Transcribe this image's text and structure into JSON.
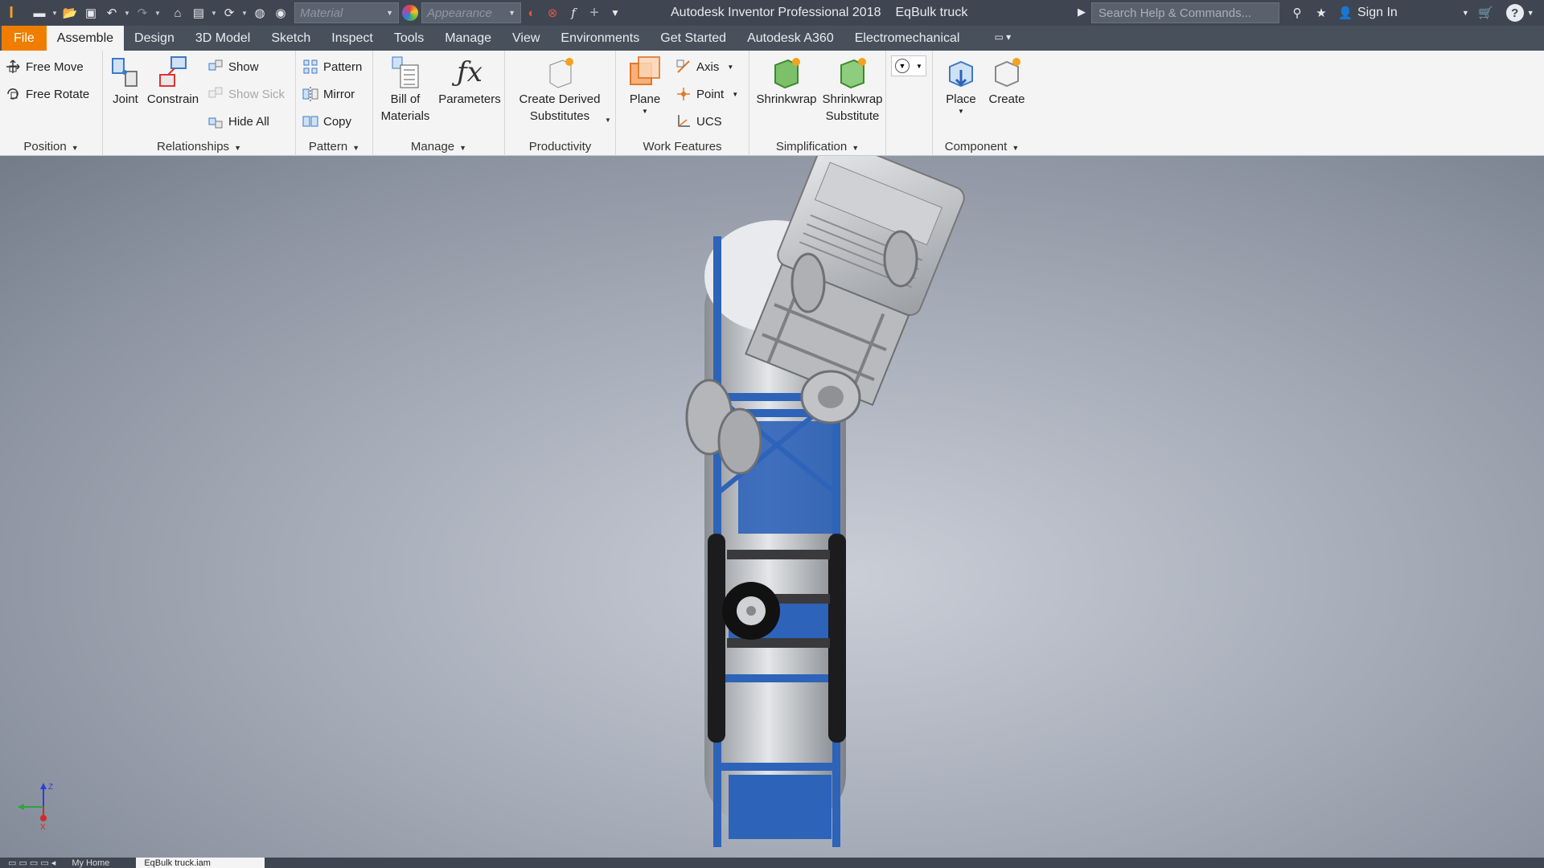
{
  "titlebar": {
    "material_placeholder": "Material",
    "appearance_placeholder": "Appearance",
    "app_title": "Autodesk Inventor Professional 2018",
    "doc_title": "EqBulk truck",
    "search_placeholder": "Search Help & Commands...",
    "sign_in": "Sign In",
    "icons": [
      "inventor-logo-icon",
      "new-icon",
      "open-icon",
      "save-icon",
      "undo-icon",
      "redo-icon",
      "home-icon",
      "print-icon",
      "update-icon",
      "select-icon",
      "globe-icon",
      "color-ball-icon",
      "appearance-adjust-icon",
      "clear-appearance-icon",
      "fx-icon",
      "add-icon",
      "customize-icon",
      "sign-in-icon",
      "star-icon",
      "user-icon",
      "cart-icon",
      "help-icon"
    ]
  },
  "tabs": [
    {
      "label": "File"
    },
    {
      "label": "Assemble"
    },
    {
      "label": "Design"
    },
    {
      "label": "3D Model"
    },
    {
      "label": "Sketch"
    },
    {
      "label": "Inspect"
    },
    {
      "label": "Tools"
    },
    {
      "label": "Manage"
    },
    {
      "label": "View"
    },
    {
      "label": "Environments"
    },
    {
      "label": "Get Started"
    },
    {
      "label": "Autodesk A360"
    },
    {
      "label": "Electromechanical"
    }
  ],
  "active_tab": "Assemble",
  "ribbon": {
    "position": {
      "label": "Position",
      "free_move": "Free Move",
      "free_rotate": "Free Rotate"
    },
    "relationships": {
      "label": "Relationships",
      "joint": "Joint",
      "constrain": "Constrain",
      "show": "Show",
      "show_sick": "Show Sick",
      "hide_all": "Hide All"
    },
    "pattern": {
      "label": "Pattern",
      "pattern": "Pattern",
      "mirror": "Mirror",
      "copy": "Copy"
    },
    "manage": {
      "label": "Manage",
      "bill_line1": "Bill of",
      "bill_line2": "Materials",
      "parameters": "Parameters"
    },
    "productivity": {
      "label": "Productivity",
      "derived_line1": "Create Derived",
      "derived_line2": "Substitutes"
    },
    "work_features": {
      "label": "Work Features",
      "plane": "Plane",
      "axis": "Axis",
      "point": "Point",
      "ucs": "UCS"
    },
    "simplification": {
      "label": "Simplification",
      "shrinkwrap": "Shrinkwrap",
      "shrinkwrap_sub_line1": "Shrinkwrap",
      "shrinkwrap_sub_line2": "Substitute"
    },
    "component": {
      "label": "Component",
      "place": "Place",
      "create": "Create"
    }
  },
  "viewport": {
    "triad_labels": {
      "z": "Z",
      "x": "X"
    }
  },
  "bottom_tabs": [
    {
      "label": "My Home"
    },
    {
      "label": "EqBulk truck.iam"
    }
  ],
  "colors": {
    "title_bg": "#3f4651",
    "file_tab": "#ef7d00",
    "ribbon_bg": "#f4f4f4",
    "frame_blue": "#2d63b8"
  }
}
